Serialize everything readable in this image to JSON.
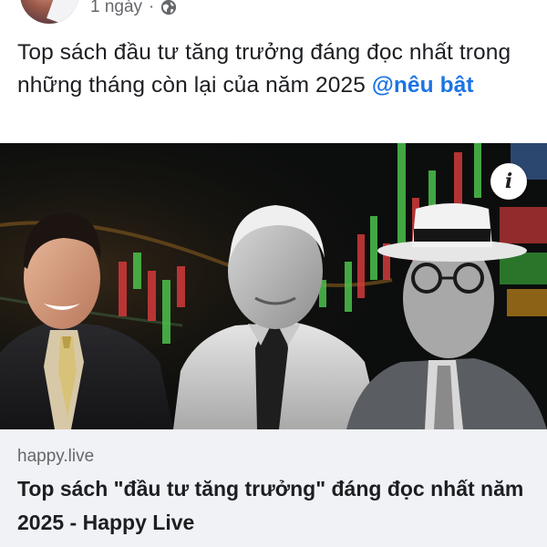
{
  "post": {
    "time": "1 ngày",
    "separator": "·",
    "privacy_icon": "globe-icon",
    "text": "Top sách đầu tư tăng trưởng đáng đọc nhất trong những tháng còn lại của năm 2025 ",
    "mention": "@nêu bật"
  },
  "link": {
    "info_icon": "info-icon",
    "info_label": "i",
    "domain": "happy.live",
    "title": "Top sách \"đầu tư tăng trưởng\" đáng đọc nhất năm 2025 - Happy Live"
  },
  "colors": {
    "mention": "#1b74e4",
    "caption_bg": "#f0f2f5",
    "secondary_text": "#65676b"
  }
}
